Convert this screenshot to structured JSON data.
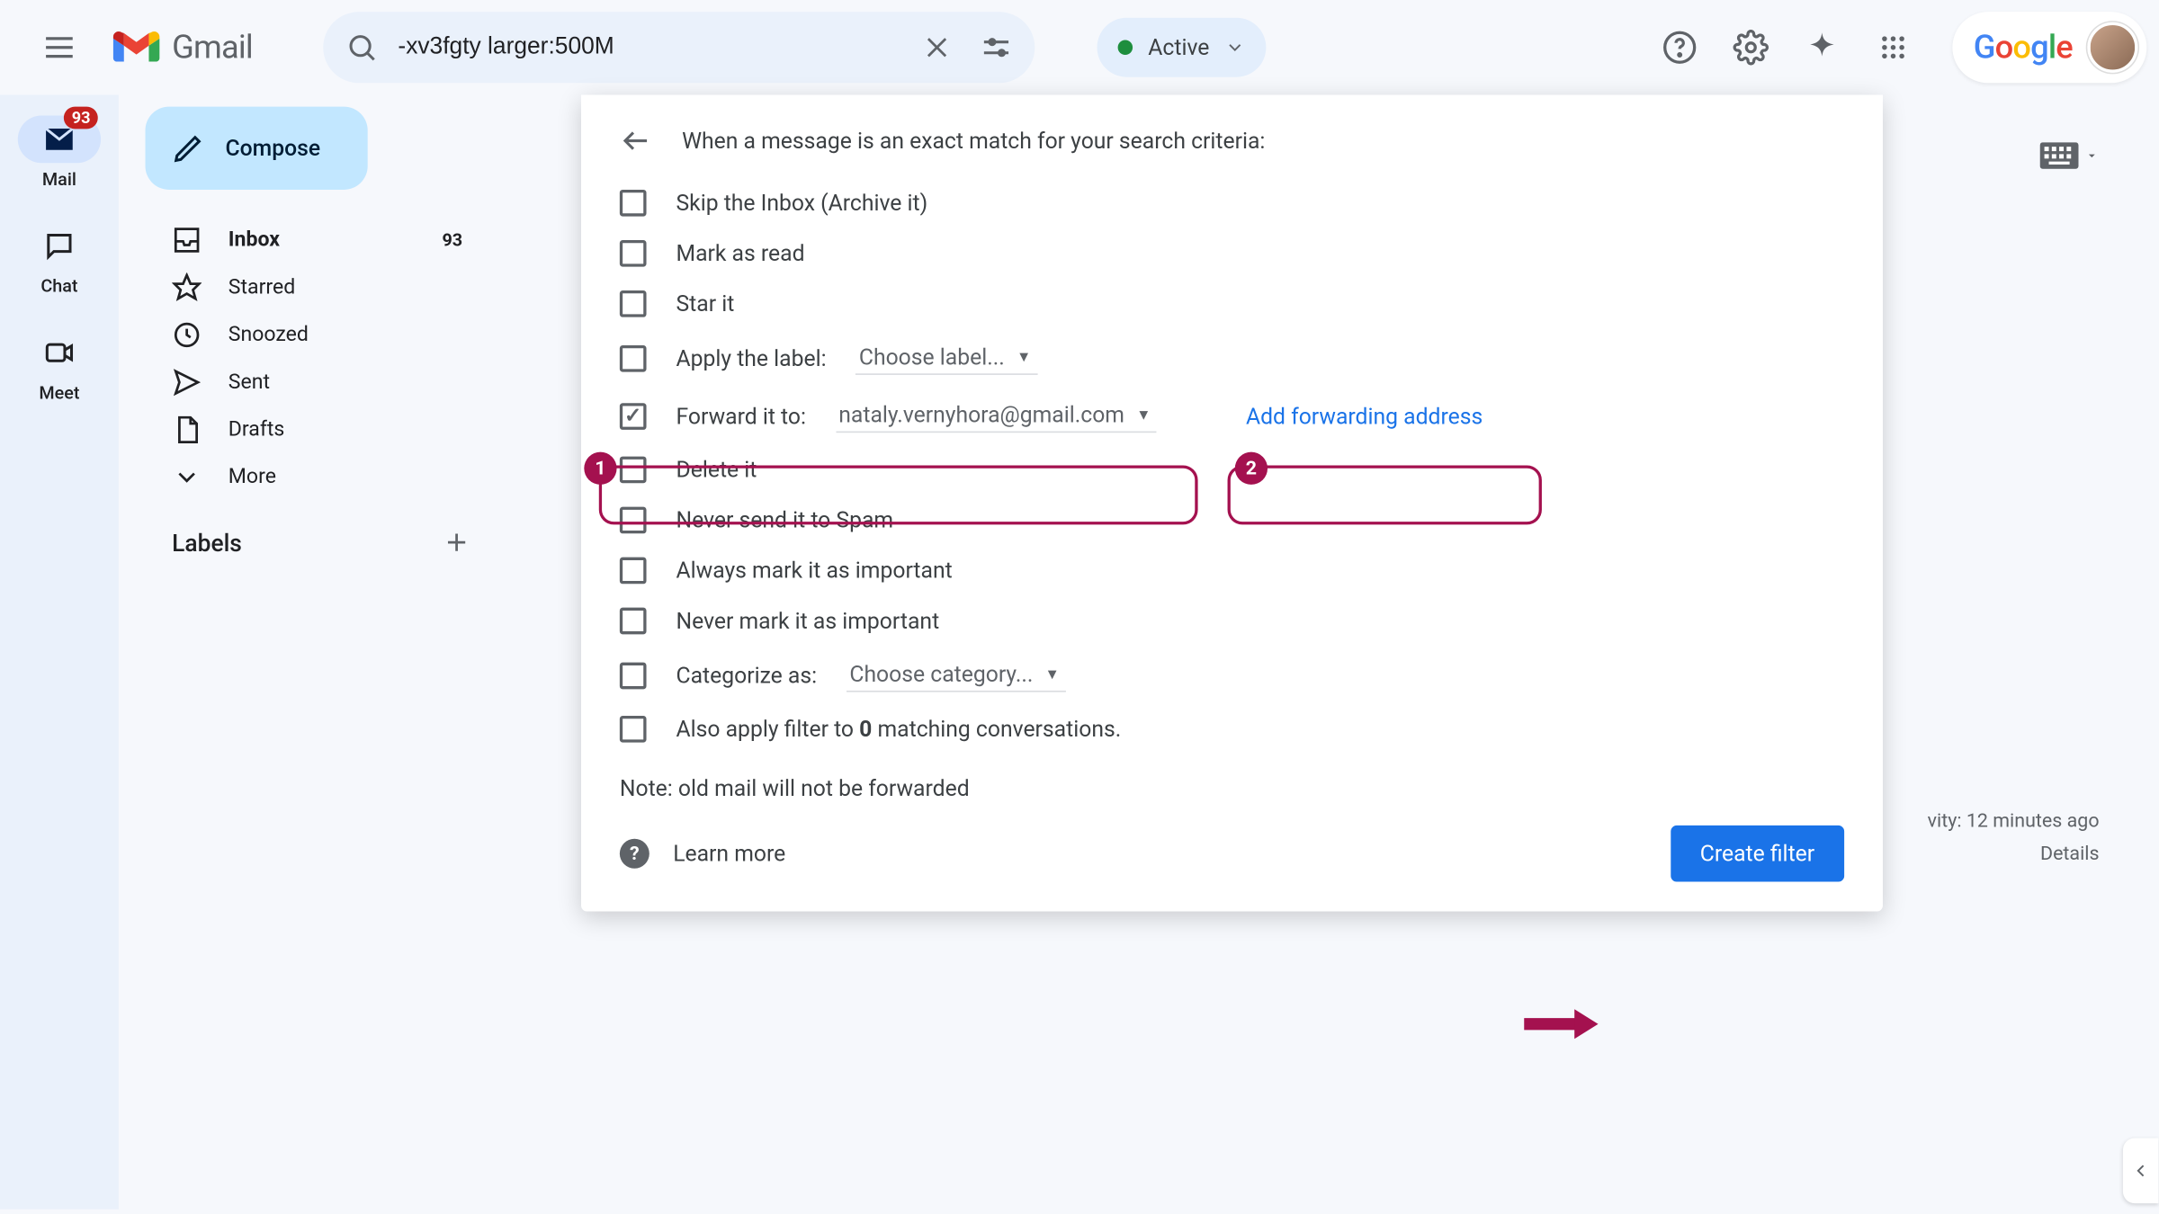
{
  "header": {
    "logo_text": "Gmail",
    "search_value": "-xv3fgty larger:500M",
    "active_label": "Active",
    "google_logo": "Google"
  },
  "rail": {
    "mail": "Mail",
    "mail_badge": "93",
    "chat": "Chat",
    "meet": "Meet"
  },
  "sidebar": {
    "compose": "Compose",
    "items": [
      {
        "label": "Inbox",
        "count": "93"
      },
      {
        "label": "Starred"
      },
      {
        "label": "Snoozed"
      },
      {
        "label": "Sent"
      },
      {
        "label": "Drafts"
      },
      {
        "label": "More"
      }
    ],
    "labels_header": "Labels"
  },
  "filter": {
    "title": "When a message is an exact match for your search criteria:",
    "options": {
      "skip_inbox": "Skip the Inbox (Archive it)",
      "mark_read": "Mark as read",
      "star_it": "Star it",
      "apply_label": "Apply the label:",
      "choose_label": "Choose label...",
      "forward_to": "Forward it to:",
      "forward_email": "nataly.vernyhora@gmail.com",
      "add_forwarding": "Add forwarding address",
      "delete_it": "Delete it",
      "never_spam": "Never send it to Spam",
      "always_important": "Always mark it as important",
      "never_important": "Never mark it as important",
      "categorize_as": "Categorize as:",
      "choose_category": "Choose category...",
      "also_apply_pre": "Also apply filter to ",
      "also_apply_count": "0",
      "also_apply_post": " matching conversations."
    },
    "note": "Note: old mail will not be forwarded",
    "learn_more": "Learn more",
    "create_filter": "Create filter"
  },
  "annotations": {
    "one": "1",
    "two": "2"
  },
  "activity": {
    "line1": "vity: 12 minutes ago",
    "line2": "Details"
  }
}
